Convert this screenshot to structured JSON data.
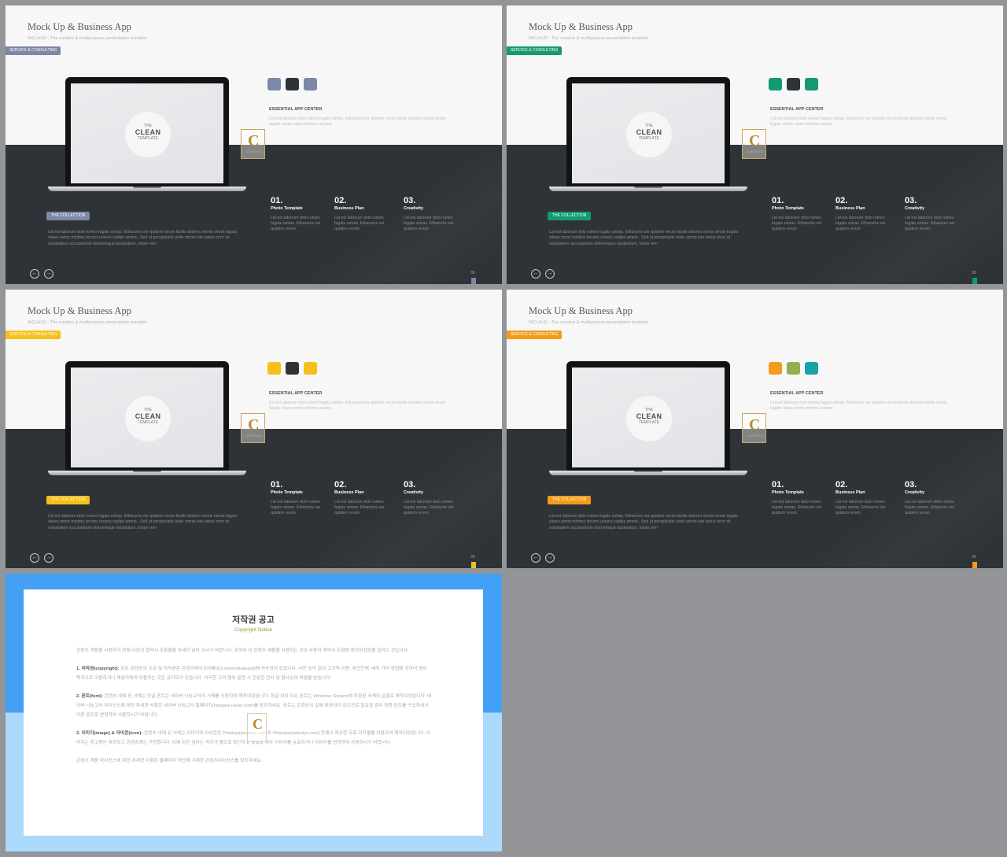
{
  "slides": [
    {
      "title": "Mock Up & Business App",
      "subtitle": "INCLAUD - The creative & multipurpose presentation template",
      "tag": "SERVICE & CONSULTING",
      "accent": "#7b88a6",
      "swatches": [
        "#7b88a6",
        "#2e3337",
        "#7b88a6"
      ],
      "laptop": {
        "line1": "THE",
        "line2": "CLEAN",
        "line3": "TEMPLATE"
      },
      "logo": {
        "glyph": "C",
        "text": "CONTENTS"
      },
      "app_heading": "ESSENTIAL APP CENTER",
      "app_text": "Lid est laborum dolo rumes fugats untras. Etharums ser quidem rerum facilis dolores nemis omnis fugats vitaes nemo minima rerums",
      "features": [
        {
          "num": "01.",
          "label": "Photo Template",
          "text": "Lid est laborum dolo rumes fugats untras. Etharums ser quidem rerum"
        },
        {
          "num": "02.",
          "label": "Business Plan",
          "text": "Lid est laborum dolo rumes fugats untras. Etharums ser quidem rerum"
        },
        {
          "num": "03.",
          "label": "Creativity",
          "text": "Lid est laborum dolo rumes fugats untras. Etharums ser quidem rerum"
        }
      ],
      "collection_tag": "THE COLLECTION",
      "collection_text": "Lid est laborum dolo rumes fugats untras. Etharums ser quidem rerum facilis dolores nemis omnis fugats vitaes nemo minima rerums unsers sadips amets.. Sed ut perspiciatis unde omnis iste natus error sit voluptatem accusantium doloremque laudantium, totam rem",
      "nav_prev": "←",
      "nav_next": "→",
      "page": "39"
    },
    {
      "title": "Mock Up & Business App",
      "subtitle": "INCLAUD - The creative & multipurpose presentation template",
      "tag": "SERVICE & CONSULTING",
      "accent": "#149a72",
      "swatches": [
        "#149a72",
        "#2e3337",
        "#149a72"
      ],
      "laptop": {
        "line1": "THE",
        "line2": "CLEAN",
        "line3": "TEMPLATE"
      },
      "logo": {
        "glyph": "C",
        "text": "CONTENTS"
      },
      "app_heading": "ESSENTIAL APP CENTER",
      "app_text": "Lid est laborum dolo rumes fugats untras. Etharums ser quidem rerum facilis dolores nemis omnis fugats vitaes nemo minima rerums",
      "features": [
        {
          "num": "01.",
          "label": "Photo Template",
          "text": "Lid est laborum dolo rumes fugats untras. Etharums ser quidem rerum"
        },
        {
          "num": "02.",
          "label": "Business Plan",
          "text": "Lid est laborum dolo rumes fugats untras. Etharums ser quidem rerum"
        },
        {
          "num": "03.",
          "label": "Creativity",
          "text": "Lid est laborum dolo rumes fugats untras. Etharums ser quidem rerum"
        }
      ],
      "collection_tag": "THE COLLECTION",
      "collection_text": "Lid est laborum dolo rumes fugats untras. Etharums ser quidem rerum facilis dolores nemis omnis fugats vitaes nemo minima rerums unsers sadips amets.. Sed ut perspiciatis unde omnis iste natus error sit voluptatem accusantium doloremque laudantium, totam rem",
      "nav_prev": "←",
      "nav_next": "→",
      "page": "39"
    },
    {
      "title": "Mock Up & Business App",
      "subtitle": "INCLAUD - The creative & multipurpose presentation template",
      "tag": "SERVICE & CONSULTING",
      "accent": "#f6c01a",
      "swatches": [
        "#f6c01a",
        "#2e3337",
        "#f6c01a"
      ],
      "laptop": {
        "line1": "THE",
        "line2": "CLEAN",
        "line3": "TEMPLATE"
      },
      "logo": {
        "glyph": "C",
        "text": "CONTENTS"
      },
      "app_heading": "ESSENTIAL APP CENTER",
      "app_text": "Lid est laborum dolo rumes fugats untras. Etharums ser quidem rerum facilis dolores nemis omnis fugats vitaes nemo minima rerums",
      "features": [
        {
          "num": "01.",
          "label": "Photo Template",
          "text": "Lid est laborum dolo rumes fugats untras. Etharums ser quidem rerum"
        },
        {
          "num": "02.",
          "label": "Business Plan",
          "text": "Lid est laborum dolo rumes fugats untras. Etharums ser quidem rerum"
        },
        {
          "num": "03.",
          "label": "Creativity",
          "text": "Lid est laborum dolo rumes fugats untras. Etharums ser quidem rerum"
        }
      ],
      "collection_tag": "THE COLLECTION",
      "collection_text": "Lid est laborum dolo rumes fugats untras. Etharums ser quidem rerum facilis dolores nemis omnis fugats vitaes nemo minima rerums unsers sadips amets.. Sed ut perspiciatis unde omnis iste natus error sit voluptatem accusantium doloremque laudantium, totam rem",
      "nav_prev": "←",
      "nav_next": "→",
      "page": "39"
    },
    {
      "title": "Mock Up & Business App",
      "subtitle": "INCLAUD - The creative & multipurpose presentation template",
      "tag": "SERVICE & CONSULTING",
      "accent": "#f39c19",
      "swatches": [
        "#f39c19",
        "#8fb04e",
        "#18a4a6"
      ],
      "laptop": {
        "line1": "THE",
        "line2": "CLEAN",
        "line3": "TEMPLATE"
      },
      "logo": {
        "glyph": "C",
        "text": "CONTENTS"
      },
      "app_heading": "ESSENTIAL APP CENTER",
      "app_text": "Lid est laborum dolo rumes fugats untras. Etharums ser quidem rerum facilis dolores nemis omnis fugats vitaes nemo minima rerums",
      "features": [
        {
          "num": "01.",
          "label": "Photo Template",
          "text": "Lid est laborum dolo rumes fugats untras. Etharums ser quidem rerum"
        },
        {
          "num": "02.",
          "label": "Business Plan",
          "text": "Lid est laborum dolo rumes fugats untras. Etharums ser quidem rerum"
        },
        {
          "num": "03.",
          "label": "Creativity",
          "text": "Lid est laborum dolo rumes fugats untras. Etharums ser quidem rerum"
        }
      ],
      "collection_tag": "THE COLLECTION",
      "collection_text": "Lid est laborum dolo rumes fugats untras. Etharums ser quidem rerum facilis dolores nemis omnis fugats vitaes nemo minima rerums unsers sadips amets.. Sed ut perspiciatis unde omnis iste natus error sit voluptatem accusantium doloremque laudantium, totam rem",
      "nav_prev": "←",
      "nav_next": "→",
      "page": "39"
    }
  ],
  "notice": {
    "title": "저작권 공고",
    "subtitle": "Copyright Notice",
    "intro": "콘텐츠 제품을 사용하기 전에 다음의 협약서 조항들을 자세히 읽어 주시기 바랍니다. 위하여 이 콘텐츠 제품을 사용하는 것은 사용자 계약서 조항에 동의하셨음을 알리는 것입니다.",
    "sections": [
      {
        "heading": "1. 저작권(copyright):",
        "text": "모든 콘텐츠의 소유 및 저작권은 콘텐츠메이크어웨이(Contentstakeout)에 귀속되어 있습니다. 사전 승낙 없이 고의적 이용, 무단전재, 배포 기타 방법에 의하여 영리 목적으로 이용하거나 제삼자에게 이용하는 것은 금지되어 있습니다. 이러한 고의 행위 발견 시 준엄한 민사 및 형사상의 처벌을 받습니다."
      },
      {
        "heading": "2. 폰트(font):",
        "text": "콘텐츠 내에 된 서체는 한글 폰트는 네이버 나눔고딕의 서체를 사용하여 제작되었습니다. 한글 외의 모든 폰트는 Windows System에 포함된 서체의 글꼴로 제작되었습니다. 네이버 나눔고딕 라이선스에 대한 자세한 사항은 네이버 나눔고딕 홈페이지(hangeul.naver.com)를 참조하세요. 폰트는 콘텐츠의 일에 제공되지 않으므로 필요할 경우 정품 폰트를 구입하셔서 다른 폰트로 변경하여 사용하시기 바랍니다."
      },
      {
        "heading": "3. 이미지(image) & 아이콘(icon):",
        "text": "콘텐츠 내에 된 서체는 이미지와 아이콘은 Pixabay(pixabay.com)와 Webalys(webalys.com) 등에서 제공한 무료 저작물을 이용하여 제작되었습니다. 이미지는 참고용만 제공되고 콘텐츠에는 구현합니다. 이에 관한 권리는 귀하가 별도로 확인하고 필요할 경우 이미지를 유료하거나 이미지를 변경하여 사용하시기 바랍니다."
      }
    ],
    "outro": "콘텐츠 제품 라이선스에 대한 자세한 사항은 홈페이지 하단에 기재한 콘텐츠라이선스를 참조하세요.",
    "logo_glyph": "C",
    "colors": {
      "top": "#44a0f4",
      "bottom": "#aad9fb"
    }
  }
}
